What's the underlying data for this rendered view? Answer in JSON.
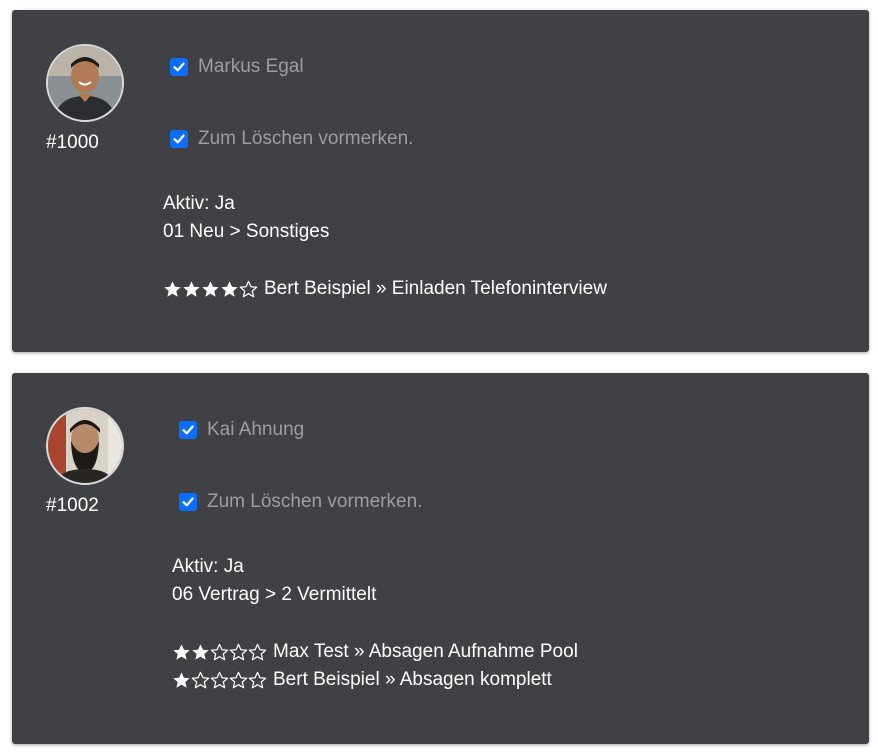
{
  "candidates": [
    {
      "name": "Markus Egal",
      "id_label": "#1000",
      "name_checked": true,
      "delete_label": "Zum Löschen vormerken.",
      "delete_checked": true,
      "active_text": "Aktiv: Ja",
      "stage_text": "01 Neu > Sonstiges",
      "ratings": [
        {
          "stars": 4,
          "max": 5,
          "text": "Bert Beispiel » Einladen Telefoninterview"
        }
      ]
    },
    {
      "name": "Kai Ahnung",
      "id_label": "#1002",
      "name_checked": true,
      "delete_label": "Zum Löschen vormerken.",
      "delete_checked": true,
      "active_text": "Aktiv: Ja",
      "stage_text": "06 Vertrag > 2 Vermittelt",
      "ratings": [
        {
          "stars": 2,
          "max": 5,
          "text": "Max Test » Absagen Aufnahme Pool"
        },
        {
          "stars": 1,
          "max": 5,
          "text": "Bert Beispiel » Absagen komplett"
        }
      ]
    }
  ],
  "colors": {
    "card_bg": "#3f4145",
    "checkbox": "#0d6efd",
    "muted_text": "#9a9ea3",
    "text": "#ffffff"
  },
  "icons": {
    "avatar": "person-photo",
    "checkbox": "checkmark-icon",
    "star_full": "star-filled-icon",
    "star_empty": "star-outline-icon"
  }
}
